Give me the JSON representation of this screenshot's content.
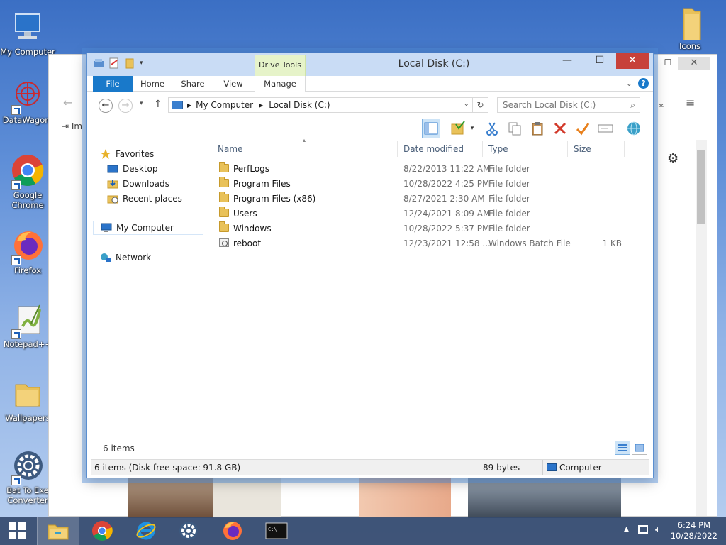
{
  "desktop": {
    "icons": [
      {
        "label": "My Computer"
      },
      {
        "label": "DataWagon."
      },
      {
        "label": "Google Chrome"
      },
      {
        "label": "Firefox"
      },
      {
        "label": "Notepad++"
      },
      {
        "label": "Wallpapers"
      },
      {
        "label": "Bat To Exe Converter"
      },
      {
        "label": "Icons"
      }
    ]
  },
  "bg_browser": {
    "import_label": "Im"
  },
  "window": {
    "title": "Local Disk (C:)",
    "contextual_tab": "Drive Tools",
    "tabs": [
      {
        "label": "File"
      },
      {
        "label": "Home"
      },
      {
        "label": "Share"
      },
      {
        "label": "View"
      },
      {
        "label": "Manage"
      }
    ],
    "address": {
      "crumbs": [
        {
          "label": "My Computer"
        },
        {
          "label": "Local Disk (C:)"
        }
      ]
    },
    "search": {
      "placeholder": "Search Local Disk (C:)"
    },
    "nav": {
      "favorites": "Favorites",
      "favorites_items": [
        {
          "label": "Desktop"
        },
        {
          "label": "Downloads"
        },
        {
          "label": "Recent places"
        }
      ],
      "computer": "My Computer",
      "network": "Network"
    },
    "columns": {
      "name": "Name",
      "date": "Date modified",
      "type": "Type",
      "size": "Size"
    },
    "files": [
      {
        "name": "PerfLogs",
        "date": "8/22/2013 11:22 AM",
        "type": "File folder",
        "size": "",
        "icon": "folder-icon"
      },
      {
        "name": "Program Files",
        "date": "10/28/2022 4:25 PM",
        "type": "File folder",
        "size": "",
        "icon": "folder-icon"
      },
      {
        "name": "Program Files (x86)",
        "date": "8/27/2021 2:30 AM",
        "type": "File folder",
        "size": "",
        "icon": "folder-icon"
      },
      {
        "name": "Users",
        "date": "12/24/2021 8:09 AM",
        "type": "File folder",
        "size": "",
        "icon": "folder-icon"
      },
      {
        "name": "Windows",
        "date": "10/28/2022 5:37 PM",
        "type": "File folder",
        "size": "",
        "icon": "folder-icon"
      },
      {
        "name": "reboot",
        "date": "12/23/2021 12:58 ...",
        "type": "Windows Batch File",
        "size": "1 KB",
        "icon": "batch-file-icon"
      }
    ],
    "items_count": "6 items",
    "status": {
      "left": "6 items (Disk free space: 91.8 GB)",
      "mid": "89 bytes",
      "right": "Computer"
    }
  },
  "taskbar": {
    "time": "6:24 PM",
    "date": "10/28/2022"
  },
  "colors": {
    "file_tab": "#1979ca",
    "drive_tools": "#e6f3c9",
    "title_bar": "#c9dcf5",
    "close": "#c7413a",
    "taskbar": "#344a6e"
  }
}
